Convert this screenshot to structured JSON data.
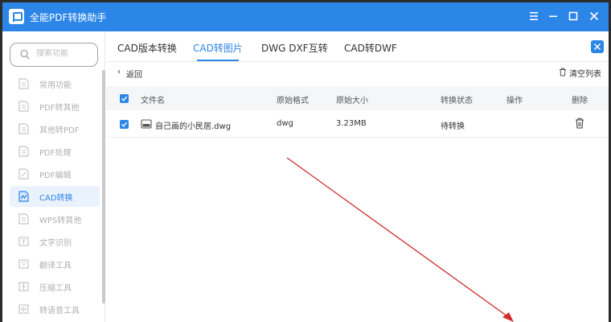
{
  "app": {
    "title": "全能PDF转换助手"
  },
  "colors": {
    "accent": "#2c86e8",
    "annotation_arrow": "#d22b2b"
  },
  "window_controls": {
    "icons": [
      "menu-icon",
      "minimize-icon",
      "maximize-icon",
      "close-icon"
    ]
  },
  "search": {
    "placeholder": "搜索功能",
    "icon": "search-icon"
  },
  "sidebar": {
    "items": [
      {
        "label": "常用功能",
        "icon": "star-doc-icon",
        "active": false
      },
      {
        "label": "PDF转其他",
        "icon": "pdf-doc-icon",
        "active": false
      },
      {
        "label": "其他转PDF",
        "icon": "convert-doc-icon",
        "active": false
      },
      {
        "label": "PDF处理",
        "icon": "process-doc-icon",
        "active": false
      },
      {
        "label": "PDF编辑",
        "icon": "edit-doc-icon",
        "active": false
      },
      {
        "label": "CAD转换",
        "icon": "cad-icon",
        "active": true
      },
      {
        "label": "WPS转其他",
        "icon": "wps-doc-icon",
        "active": false
      },
      {
        "label": "文字识别",
        "icon": "ocr-icon",
        "active": false
      },
      {
        "label": "翻译工具",
        "icon": "translate-icon",
        "active": false
      },
      {
        "label": "压缩工具",
        "icon": "compress-icon",
        "active": false
      },
      {
        "label": "转语音工具",
        "icon": "audio-icon",
        "active": false
      }
    ]
  },
  "tabs": [
    {
      "label": "CAD版本转换",
      "active": false
    },
    {
      "label": "CAD转图片",
      "active": true
    },
    {
      "label": "DWG DXF互转",
      "active": false
    },
    {
      "label": "CAD转DWF",
      "active": false
    }
  ],
  "toolbar": {
    "back_label": "返回",
    "back_glyph": "‹",
    "clear_label": "清空列表"
  },
  "table": {
    "columns": [
      "文件名",
      "原始格式",
      "原始大小",
      "转换状态",
      "操作",
      "删除"
    ],
    "rows": [
      {
        "checked": true,
        "file_name": "自己画的小民居.dwg",
        "format": "dwg",
        "size": "3.23MB",
        "status": "待转换",
        "operation": ""
      }
    ]
  }
}
